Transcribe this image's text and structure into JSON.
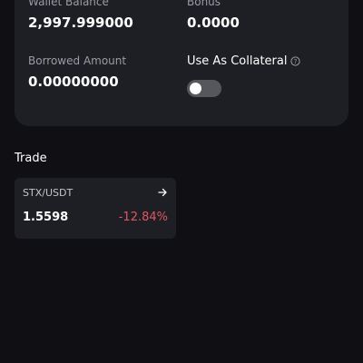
{
  "balance_card": {
    "wallet_balance_label": "Wallet Balance",
    "wallet_balance_value": "2,997.999000",
    "bonus_label": "Bonus",
    "bonus_value": "0.0000",
    "borrowed_amount_label": "Borrowed Amount",
    "borrowed_amount_value": "0.00000000",
    "collateral_label": "Use As Collateral",
    "collateral_enabled": false,
    "info_icon": "info-circle-icon"
  },
  "trade": {
    "section_title": "Trade",
    "items": [
      {
        "pair": "STX/USDT",
        "price": "1.5598",
        "change": "-12.84%",
        "arrow_icon": "arrow-right-icon"
      }
    ]
  },
  "colors": {
    "background": "#101014",
    "card": "#1e1f24",
    "negative": "#e05561",
    "muted_text": "#9a9ca3",
    "toggle_off": "#56575c"
  }
}
